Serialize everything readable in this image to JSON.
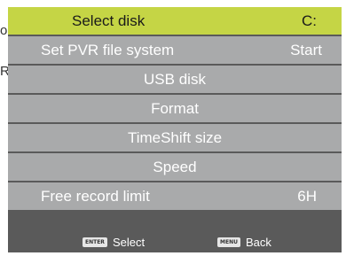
{
  "background": {
    "fragment_1": "o",
    "fragment_2": "R"
  },
  "menu": {
    "rows": [
      {
        "label": "Select disk",
        "value": "C:"
      },
      {
        "label": "Set PVR file system",
        "value": "Start"
      },
      {
        "label": "USB disk",
        "value": ""
      },
      {
        "label": "Format",
        "value": ""
      },
      {
        "label": "TimeShift size",
        "value": ""
      },
      {
        "label": "Speed",
        "value": ""
      },
      {
        "label": "Free record limit",
        "value": "6H"
      }
    ]
  },
  "footer": {
    "enter_key": "ENTER",
    "enter_label": "Select",
    "menu_key": "MENU",
    "menu_label": "Back"
  },
  "colors": {
    "selected_row": "#c5d545",
    "row": "#a9aaab",
    "panel": "#5a5a5a"
  }
}
